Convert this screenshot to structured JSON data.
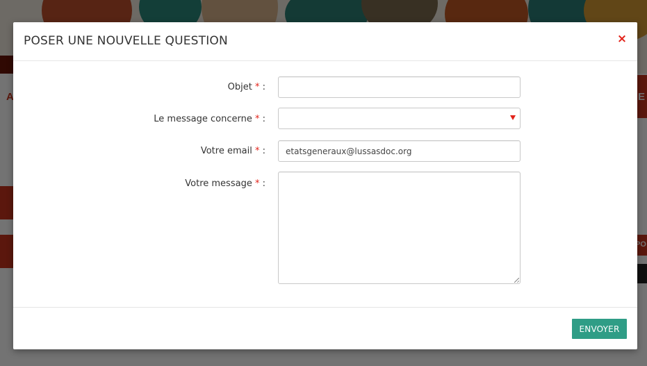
{
  "modal": {
    "title": "POSER UNE NOUVELLE QUESTION",
    "close_glyph": "×",
    "fields": {
      "subject": {
        "label": "Objet",
        "required_mark": "*",
        "separator": ":",
        "value": ""
      },
      "concerns": {
        "label": "Le message concerne",
        "required_mark": "*",
        "separator": ":",
        "value": ""
      },
      "email": {
        "label": "Votre email",
        "required_mark": "*",
        "separator": ":",
        "value": "etatsgeneraux@lussasdoc.org"
      },
      "message": {
        "label": "Votre message",
        "required_mark": "*",
        "separator": ":",
        "value": ""
      }
    },
    "submit_label": "ENVOYER"
  },
  "background": {
    "left_letter": "A",
    "right_letter": "E",
    "right_tab_text": "PO"
  },
  "colors": {
    "accent_red": "#e2231a",
    "submit_green": "#2f9d86",
    "bg_red": "#c9331d"
  },
  "icons": {
    "close": "close-icon",
    "select": "dropdown-arrow-icon",
    "resize": "resize-grip-icon"
  }
}
